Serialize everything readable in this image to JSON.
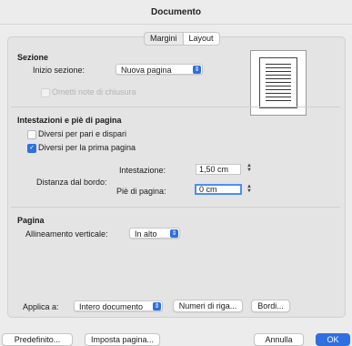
{
  "window": {
    "title": "Documento"
  },
  "tabs": [
    {
      "label": "Margini",
      "selected": false
    },
    {
      "label": "Layout",
      "selected": true
    }
  ],
  "section": {
    "heading": "Sezione",
    "start_label": "Inizio sezione:",
    "start_value": "Nuova pagina",
    "suppress_endnotes": {
      "label": "Ometti note di chiusura",
      "checked": false,
      "enabled": false
    }
  },
  "headers_footers": {
    "heading": "Intestazioni e piè di pagina",
    "different_odd_even": {
      "label": "Diversi per pari e dispari",
      "checked": false
    },
    "different_first_page": {
      "label": "Diversi per la prima pagina",
      "checked": true
    },
    "distance_label": "Distanza dal bordo:",
    "header_label": "Intestazione:",
    "header_value": "1,50 cm",
    "footer_label": "Piè di pagina:",
    "footer_value": "0 cm"
  },
  "page": {
    "heading": "Pagina",
    "vertical_alignment_label": "Allineamento verticale:",
    "vertical_alignment_value": "In alto"
  },
  "apply": {
    "label": "Applica a:",
    "value": "Intero documento",
    "line_numbers_button": "Numeri di riga...",
    "borders_button": "Bordi..."
  },
  "footer_buttons": {
    "default": "Predefinito...",
    "page_setup": "Imposta pagina...",
    "cancel": "Annulla",
    "ok": "OK"
  },
  "colors": {
    "accent": "#2f6fe0",
    "background": "#ececec"
  },
  "icons": {
    "popup_arrow": "chevron-updown-icon",
    "checkmark": "checkmark-icon",
    "stepper": "stepper-arrows-icon"
  }
}
